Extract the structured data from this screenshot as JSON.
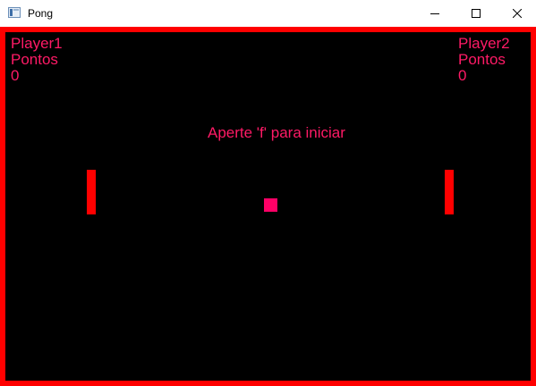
{
  "window": {
    "title": "Pong",
    "controls": {
      "minimize_icon": "minimize-icon",
      "maximize_icon": "maximize-icon",
      "close_icon": "close-icon"
    }
  },
  "game": {
    "prompt": "Aperte 'f' para iniciar",
    "player1": {
      "name": "Player1",
      "points_label": "Pontos",
      "score": "0"
    },
    "player2": {
      "name": "Player2",
      "points_label": "Pontos",
      "score": "0"
    },
    "colors": {
      "background": "#000000",
      "border": "#ff0000",
      "text": "#ff1a66",
      "paddle": "#ff0000",
      "ball": "#ff0066"
    }
  }
}
